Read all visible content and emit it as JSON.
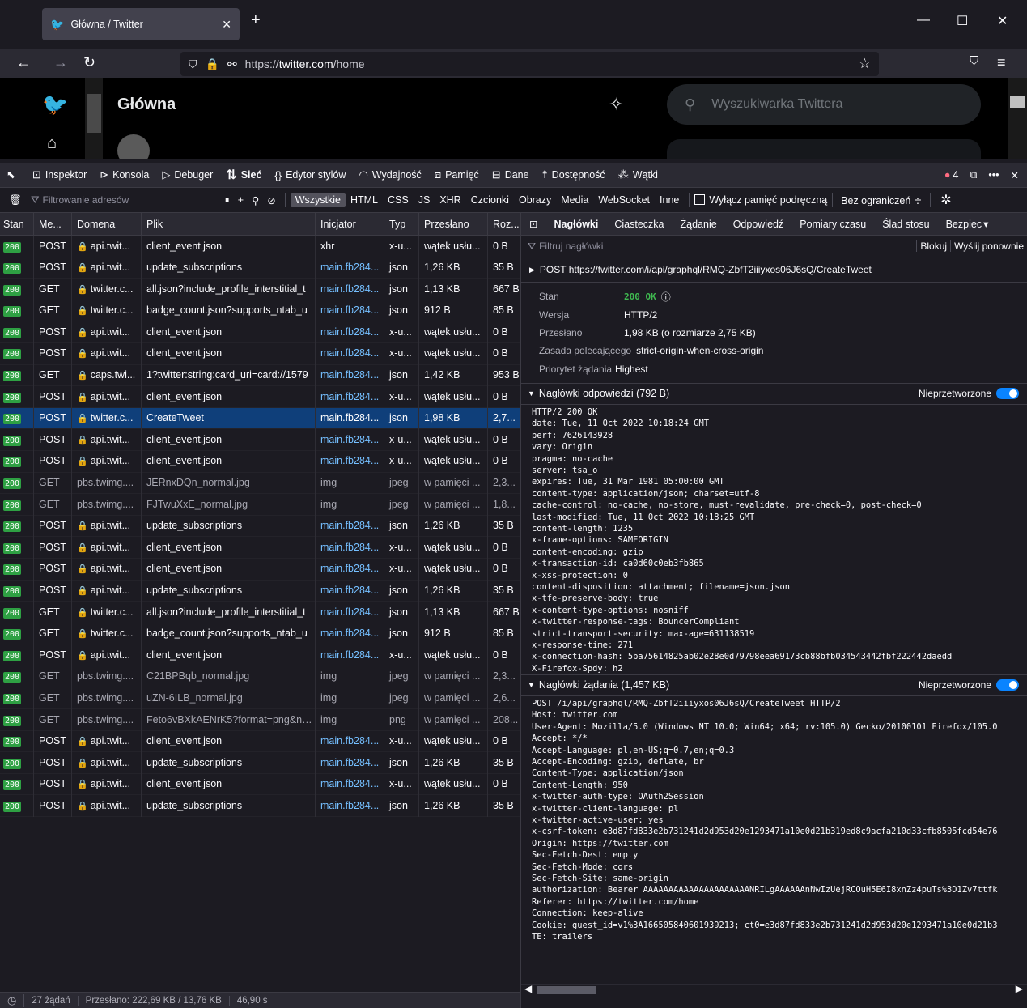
{
  "browser": {
    "tab_title": "Główna / Twitter",
    "url_prefix": "https://",
    "url_host": "twitter.com",
    "url_path": "/home"
  },
  "twitter": {
    "home_title": "Główna",
    "search_placeholder": "Wyszukiwarka Twittera"
  },
  "devtools": {
    "tabs": [
      {
        "label": "Inspektor",
        "icon": "inspector-icon"
      },
      {
        "label": "Konsola",
        "icon": "console-icon"
      },
      {
        "label": "Debuger",
        "icon": "debugger-icon"
      },
      {
        "label": "Sieć",
        "icon": "network-icon"
      },
      {
        "label": "Edytor stylów",
        "icon": "style-editor-icon"
      },
      {
        "label": "Wydajność",
        "icon": "performance-icon"
      },
      {
        "label": "Pamięć",
        "icon": "memory-icon"
      },
      {
        "label": "Dane",
        "icon": "storage-icon"
      },
      {
        "label": "Dostępność",
        "icon": "accessibility-icon"
      },
      {
        "label": "Wątki",
        "icon": "threads-icon"
      }
    ],
    "error_count": "4",
    "url_filter_placeholder": "Filtrowanie adresów",
    "type_filters": [
      "Wszystkie",
      "HTML",
      "CSS",
      "JS",
      "XHR",
      "Czcionki",
      "Obrazy",
      "Media",
      "WebSocket",
      "Inne"
    ],
    "disable_cache_label": "Wyłącz pamięć podręczną",
    "throttle_label": "Bez ograniczeń ≑"
  },
  "columns": [
    "Stan",
    "Me...",
    "Domena",
    "Plik",
    "Inicjator",
    "Typ",
    "Przesłano",
    "Roz..."
  ],
  "requests": [
    {
      "status": "200",
      "method": "POST",
      "domain": "api.twit...",
      "lock": true,
      "file": "client_event.json",
      "initiator": "xhr",
      "init_link": false,
      "type": "x-u...",
      "transferred": "wątek usłu...",
      "size": "0 B",
      "cached": false,
      "selected": false
    },
    {
      "status": "200",
      "method": "POST",
      "domain": "api.twit...",
      "lock": true,
      "file": "update_subscriptions",
      "initiator": "main.fb284...",
      "init_link": true,
      "type": "json",
      "transferred": "1,26 KB",
      "size": "35 B",
      "cached": false,
      "selected": false
    },
    {
      "status": "200",
      "method": "GET",
      "domain": "twitter.c...",
      "lock": true,
      "file": "all.json?include_profile_interstitial_t",
      "initiator": "main.fb284...",
      "init_link": true,
      "type": "json",
      "transferred": "1,13 KB",
      "size": "667 B",
      "cached": false,
      "selected": false
    },
    {
      "status": "200",
      "method": "GET",
      "domain": "twitter.c...",
      "lock": true,
      "file": "badge_count.json?supports_ntab_u",
      "initiator": "main.fb284...",
      "init_link": true,
      "type": "json",
      "transferred": "912 B",
      "size": "85 B",
      "cached": false,
      "selected": false
    },
    {
      "status": "200",
      "method": "POST",
      "domain": "api.twit...",
      "lock": true,
      "file": "client_event.json",
      "initiator": "main.fb284...",
      "init_link": true,
      "type": "x-u...",
      "transferred": "wątek usłu...",
      "size": "0 B",
      "cached": false,
      "selected": false
    },
    {
      "status": "200",
      "method": "POST",
      "domain": "api.twit...",
      "lock": true,
      "file": "client_event.json",
      "initiator": "main.fb284...",
      "init_link": true,
      "type": "x-u...",
      "transferred": "wątek usłu...",
      "size": "0 B",
      "cached": false,
      "selected": false
    },
    {
      "status": "200",
      "method": "GET",
      "domain": "caps.twi...",
      "lock": true,
      "file": "1?twitter:string:card_uri=card://1579",
      "initiator": "main.fb284...",
      "init_link": true,
      "type": "json",
      "transferred": "1,42 KB",
      "size": "953 B",
      "cached": false,
      "selected": false
    },
    {
      "status": "200",
      "method": "POST",
      "domain": "api.twit...",
      "lock": true,
      "file": "client_event.json",
      "initiator": "main.fb284...",
      "init_link": true,
      "type": "x-u...",
      "transferred": "wątek usłu...",
      "size": "0 B",
      "cached": false,
      "selected": false
    },
    {
      "status": "200",
      "method": "POST",
      "domain": "twitter.c...",
      "lock": true,
      "file": "CreateTweet",
      "initiator": "main.fb284...",
      "init_link": true,
      "type": "json",
      "transferred": "1,98 KB",
      "size": "2,7...",
      "cached": false,
      "selected": true
    },
    {
      "status": "200",
      "method": "POST",
      "domain": "api.twit...",
      "lock": true,
      "file": "client_event.json",
      "initiator": "main.fb284...",
      "init_link": true,
      "type": "x-u...",
      "transferred": "wątek usłu...",
      "size": "0 B",
      "cached": false,
      "selected": false
    },
    {
      "status": "200",
      "method": "POST",
      "domain": "api.twit...",
      "lock": true,
      "file": "client_event.json",
      "initiator": "main.fb284...",
      "init_link": true,
      "type": "x-u...",
      "transferred": "wątek usłu...",
      "size": "0 B",
      "cached": false,
      "selected": false
    },
    {
      "status": "200",
      "method": "GET",
      "domain": "pbs.twimg....",
      "lock": false,
      "file": "JERnxDQn_normal.jpg",
      "initiator": "img",
      "init_link": false,
      "type": "jpeg",
      "transferred": "w pamięci ...",
      "size": "2,3...",
      "cached": true,
      "selected": false
    },
    {
      "status": "200",
      "method": "GET",
      "domain": "pbs.twimg....",
      "lock": false,
      "file": "FJTwuXxE_normal.jpg",
      "initiator": "img",
      "init_link": false,
      "type": "jpeg",
      "transferred": "w pamięci ...",
      "size": "1,8...",
      "cached": true,
      "selected": false
    },
    {
      "status": "200",
      "method": "POST",
      "domain": "api.twit...",
      "lock": true,
      "file": "update_subscriptions",
      "initiator": "main.fb284...",
      "init_link": true,
      "type": "json",
      "transferred": "1,26 KB",
      "size": "35 B",
      "cached": false,
      "selected": false
    },
    {
      "status": "200",
      "method": "POST",
      "domain": "api.twit...",
      "lock": true,
      "file": "client_event.json",
      "initiator": "main.fb284...",
      "init_link": true,
      "type": "x-u...",
      "transferred": "wątek usłu...",
      "size": "0 B",
      "cached": false,
      "selected": false
    },
    {
      "status": "200",
      "method": "POST",
      "domain": "api.twit...",
      "lock": true,
      "file": "client_event.json",
      "initiator": "main.fb284...",
      "init_link": true,
      "type": "x-u...",
      "transferred": "wątek usłu...",
      "size": "0 B",
      "cached": false,
      "selected": false
    },
    {
      "status": "200",
      "method": "POST",
      "domain": "api.twit...",
      "lock": true,
      "file": "update_subscriptions",
      "initiator": "main.fb284...",
      "init_link": true,
      "type": "json",
      "transferred": "1,26 KB",
      "size": "35 B",
      "cached": false,
      "selected": false
    },
    {
      "status": "200",
      "method": "GET",
      "domain": "twitter.c...",
      "lock": true,
      "file": "all.json?include_profile_interstitial_t",
      "initiator": "main.fb284...",
      "init_link": true,
      "type": "json",
      "transferred": "1,13 KB",
      "size": "667 B",
      "cached": false,
      "selected": false
    },
    {
      "status": "200",
      "method": "GET",
      "domain": "twitter.c...",
      "lock": true,
      "file": "badge_count.json?supports_ntab_u",
      "initiator": "main.fb284...",
      "init_link": true,
      "type": "json",
      "transferred": "912 B",
      "size": "85 B",
      "cached": false,
      "selected": false
    },
    {
      "status": "200",
      "method": "POST",
      "domain": "api.twit...",
      "lock": true,
      "file": "client_event.json",
      "initiator": "main.fb284...",
      "init_link": true,
      "type": "x-u...",
      "transferred": "wątek usłu...",
      "size": "0 B",
      "cached": false,
      "selected": false
    },
    {
      "status": "200",
      "method": "GET",
      "domain": "pbs.twimg....",
      "lock": false,
      "file": "C21BPBqb_normal.jpg",
      "initiator": "img",
      "init_link": false,
      "type": "jpeg",
      "transferred": "w pamięci ...",
      "size": "2,3...",
      "cached": true,
      "selected": false
    },
    {
      "status": "200",
      "method": "GET",
      "domain": "pbs.twimg....",
      "lock": false,
      "file": "uZN-6ILB_normal.jpg",
      "initiator": "img",
      "init_link": false,
      "type": "jpeg",
      "transferred": "w pamięci ...",
      "size": "2,6...",
      "cached": true,
      "selected": false
    },
    {
      "status": "200",
      "method": "GET",
      "domain": "pbs.twimg....",
      "lock": false,
      "file": "Feto6vBXkAENrK5?format=png&nam",
      "initiator": "img",
      "init_link": false,
      "type": "png",
      "transferred": "w pamięci ...",
      "size": "208...",
      "cached": true,
      "selected": false
    },
    {
      "status": "200",
      "method": "POST",
      "domain": "api.twit...",
      "lock": true,
      "file": "client_event.json",
      "initiator": "main.fb284...",
      "init_link": true,
      "type": "x-u...",
      "transferred": "wątek usłu...",
      "size": "0 B",
      "cached": false,
      "selected": false
    },
    {
      "status": "200",
      "method": "POST",
      "domain": "api.twit...",
      "lock": true,
      "file": "update_subscriptions",
      "initiator": "main.fb284...",
      "init_link": true,
      "type": "json",
      "transferred": "1,26 KB",
      "size": "35 B",
      "cached": false,
      "selected": false
    },
    {
      "status": "200",
      "method": "POST",
      "domain": "api.twit...",
      "lock": true,
      "file": "client_event.json",
      "initiator": "main.fb284...",
      "init_link": true,
      "type": "x-u...",
      "transferred": "wątek usłu...",
      "size": "0 B",
      "cached": false,
      "selected": false
    },
    {
      "status": "200",
      "method": "POST",
      "domain": "api.twit...",
      "lock": true,
      "file": "update_subscriptions",
      "initiator": "main.fb284...",
      "init_link": true,
      "type": "json",
      "transferred": "1,26 KB",
      "size": "35 B",
      "cached": false,
      "selected": false
    }
  ],
  "status": {
    "requests": "27 żądań",
    "transferred": "Przesłano: 222,69 KB / 13,76 KB",
    "time": "46,90 s"
  },
  "panel": {
    "tabs": [
      "Nagłówki",
      "Ciasteczka",
      "Żądanie",
      "Odpowiedź",
      "Pomiary czasu",
      "Ślad stosu",
      "Bezpiec"
    ],
    "filter_placeholder": "Filtruj nagłówki",
    "block_label": "Blokuj",
    "resend_label": "Wyślij ponownie",
    "request_line": "POST https://twitter.com/i/api/graphql/RMQ-ZbfT2iiiyxos06J6sQ/CreateTweet",
    "summary": [
      {
        "key": "Stan",
        "value": "200 OK"
      },
      {
        "key": "Wersja",
        "value": "HTTP/2"
      },
      {
        "key": "Przesłano",
        "value": "1,98 KB (o rozmiarze 2,75 KB)"
      },
      {
        "key": "Zasada polecającego",
        "value": "strict-origin-when-cross-origin"
      },
      {
        "key": "Priorytet żądania",
        "value": "Highest"
      }
    ],
    "resp_headers_title": "Nagłówki odpowiedzi (792 B)",
    "req_headers_title": "Nagłówki żądania (1,457 KB)",
    "raw_label": "Nieprzetworzone",
    "response_headers": [
      "HTTP/2 200 OK",
      "date: Tue, 11 Oct 2022 10:18:24 GMT",
      "perf: 7626143928",
      "vary: Origin",
      "pragma: no-cache",
      "server: tsa_o",
      "expires: Tue, 31 Mar 1981 05:00:00 GMT",
      "content-type: application/json; charset=utf-8",
      "cache-control: no-cache, no-store, must-revalidate, pre-check=0, post-check=0",
      "last-modified: Tue, 11 Oct 2022 10:18:25 GMT",
      "content-length: 1235",
      "x-frame-options: SAMEORIGIN",
      "content-encoding: gzip",
      "x-transaction-id: ca0d60c0eb3fb865",
      "x-xss-protection: 0",
      "content-disposition: attachment; filename=json.json",
      "x-tfe-preserve-body: true",
      "x-content-type-options: nosniff",
      "x-twitter-response-tags: BouncerCompliant",
      "strict-transport-security: max-age=631138519",
      "x-response-time: 271",
      "x-connection-hash: 5ba75614825ab02e28e0d79798eea69173cb88bfb034543442fbf222442daedd",
      "X-Firefox-Spdy: h2"
    ],
    "request_headers": [
      "POST /i/api/graphql/RMQ-ZbfT2iiiyxos06J6sQ/CreateTweet HTTP/2",
      "Host: twitter.com",
      "User-Agent: Mozilla/5.0 (Windows NT 10.0; Win64; x64; rv:105.0) Gecko/20100101 Firefox/105.0",
      "Accept: */*",
      "Accept-Language: pl,en-US;q=0.7,en;q=0.3",
      "Accept-Encoding: gzip, deflate, br",
      "Content-Type: application/json",
      "Content-Length: 950",
      "x-twitter-auth-type: OAuth2Session",
      "x-twitter-client-language: pl",
      "x-twitter-active-user: yes",
      "x-csrf-token: e3d87fd833e2b731241d2d953d20e1293471a10e0d21b319ed8c9acfa210d33cfb8505fcd54e76",
      "Origin: https://twitter.com",
      "Sec-Fetch-Dest: empty",
      "Sec-Fetch-Mode: cors",
      "Sec-Fetch-Site: same-origin",
      "authorization: Bearer AAAAAAAAAAAAAAAAAAAAANRILgAAAAAAnNwIzUejRCOuH5E6I8xnZz4puTs%3D1Zv7ttfk",
      "Referer: https://twitter.com/home",
      "Connection: keep-alive",
      "Cookie: guest_id=v1%3A166505840601939213; ct0=e3d87fd833e2b731241d2d953d20e1293471a10e0d21b3",
      "TE: trailers"
    ]
  }
}
